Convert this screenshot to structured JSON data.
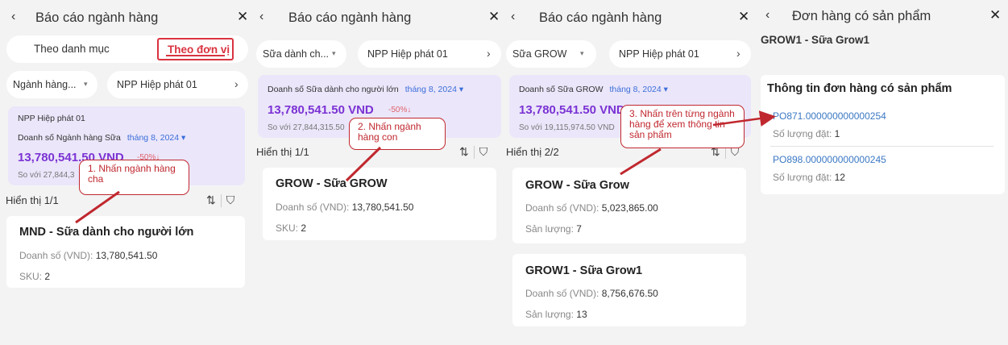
{
  "panel1": {
    "title": "Báo cáo ngành hàng",
    "tab_category": "Theo danh mục",
    "tab_unit": "Theo đơn vị",
    "filter_category": "Ngành hàng...",
    "filter_distributor": "NPP Hiệp phát 01",
    "summary": {
      "distributor": "NPP Hiệp phát 01",
      "label": "Doanh số Ngành hàng Sữa",
      "month": "tháng 8, 2024",
      "amount": "13,780,541.50 VND",
      "change": "-50%↓",
      "compare": "So với 27,844,3"
    },
    "showing": "Hiển thị 1/1",
    "card": {
      "title": "MND - Sữa dành cho người lớn",
      "sales_label": "Doanh số (VND):",
      "sales_value": "13,780,541.50",
      "sku_label": "SKU:",
      "sku_value": "2"
    }
  },
  "panel2": {
    "title": "Báo cáo ngành hàng",
    "filter_category": "Sữa dành ch...",
    "filter_distributor": "NPP Hiệp phát 01",
    "summary": {
      "label": "Doanh số Sữa dành cho người lớn",
      "month": "tháng 8, 2024",
      "amount": "13,780,541.50 VND",
      "change": "-50%↓",
      "compare": "So với 27,844,315.50"
    },
    "showing": "Hiển thị 1/1",
    "card": {
      "title": "GROW - Sữa GROW",
      "sales_label": "Doanh số (VND):",
      "sales_value": "13,780,541.50",
      "sku_label": "SKU:",
      "sku_value": "2"
    }
  },
  "panel3": {
    "title": "Báo cáo ngành hàng",
    "filter_category": "Sữa GROW",
    "filter_distributor": "NPP Hiệp phát 01",
    "summary": {
      "label": "Doanh số Sữa GROW",
      "month": "tháng 8, 2024",
      "amount": "13,780,541.50 VND",
      "compare": "So với 19,115,974.50 VND"
    },
    "showing": "Hiển thị 2/2",
    "cards": [
      {
        "title": "GROW - Sữa Grow",
        "sales_label": "Doanh số (VND):",
        "sales_value": "5,023,865.00",
        "qty_label": "Sản lượng:",
        "qty_value": "7"
      },
      {
        "title": "GROW1 - Sữa Grow1",
        "sales_label": "Doanh số (VND):",
        "sales_value": "8,756,676.50",
        "qty_label": "Sản lượng:",
        "qty_value": "13"
      }
    ]
  },
  "panel4": {
    "title": "Đơn hàng có sản phẩm",
    "subtitle": "GROW1 - Sữa Grow1",
    "card_title": "Thông tin đơn hàng có sản phẩm",
    "orders": [
      {
        "code": "PO871.000000000000254",
        "qty_label": "Số lượng đặt:",
        "qty": "1"
      },
      {
        "code": "PO898.000000000000245",
        "qty_label": "Số lượng đặt:",
        "qty": "12"
      }
    ]
  },
  "annotations": {
    "step1": "1. Nhấn ngành hàng cha",
    "step2": "2. Nhấn ngành hàng con",
    "step3": "3. Nhấn trên từng ngành hàng để xem thông tin sản phẩm"
  },
  "icons": {
    "back": "‹",
    "close": "✕",
    "caret": "▾",
    "chevron": "›",
    "sort": "⇅",
    "filter": "⛉"
  },
  "colors": {
    "accent_red": "#d9333f",
    "summary_bg": "#ebe6fa",
    "amount_purple": "#7b33d4",
    "link_blue": "#3b78c4",
    "callout_red": "#c0282f"
  }
}
